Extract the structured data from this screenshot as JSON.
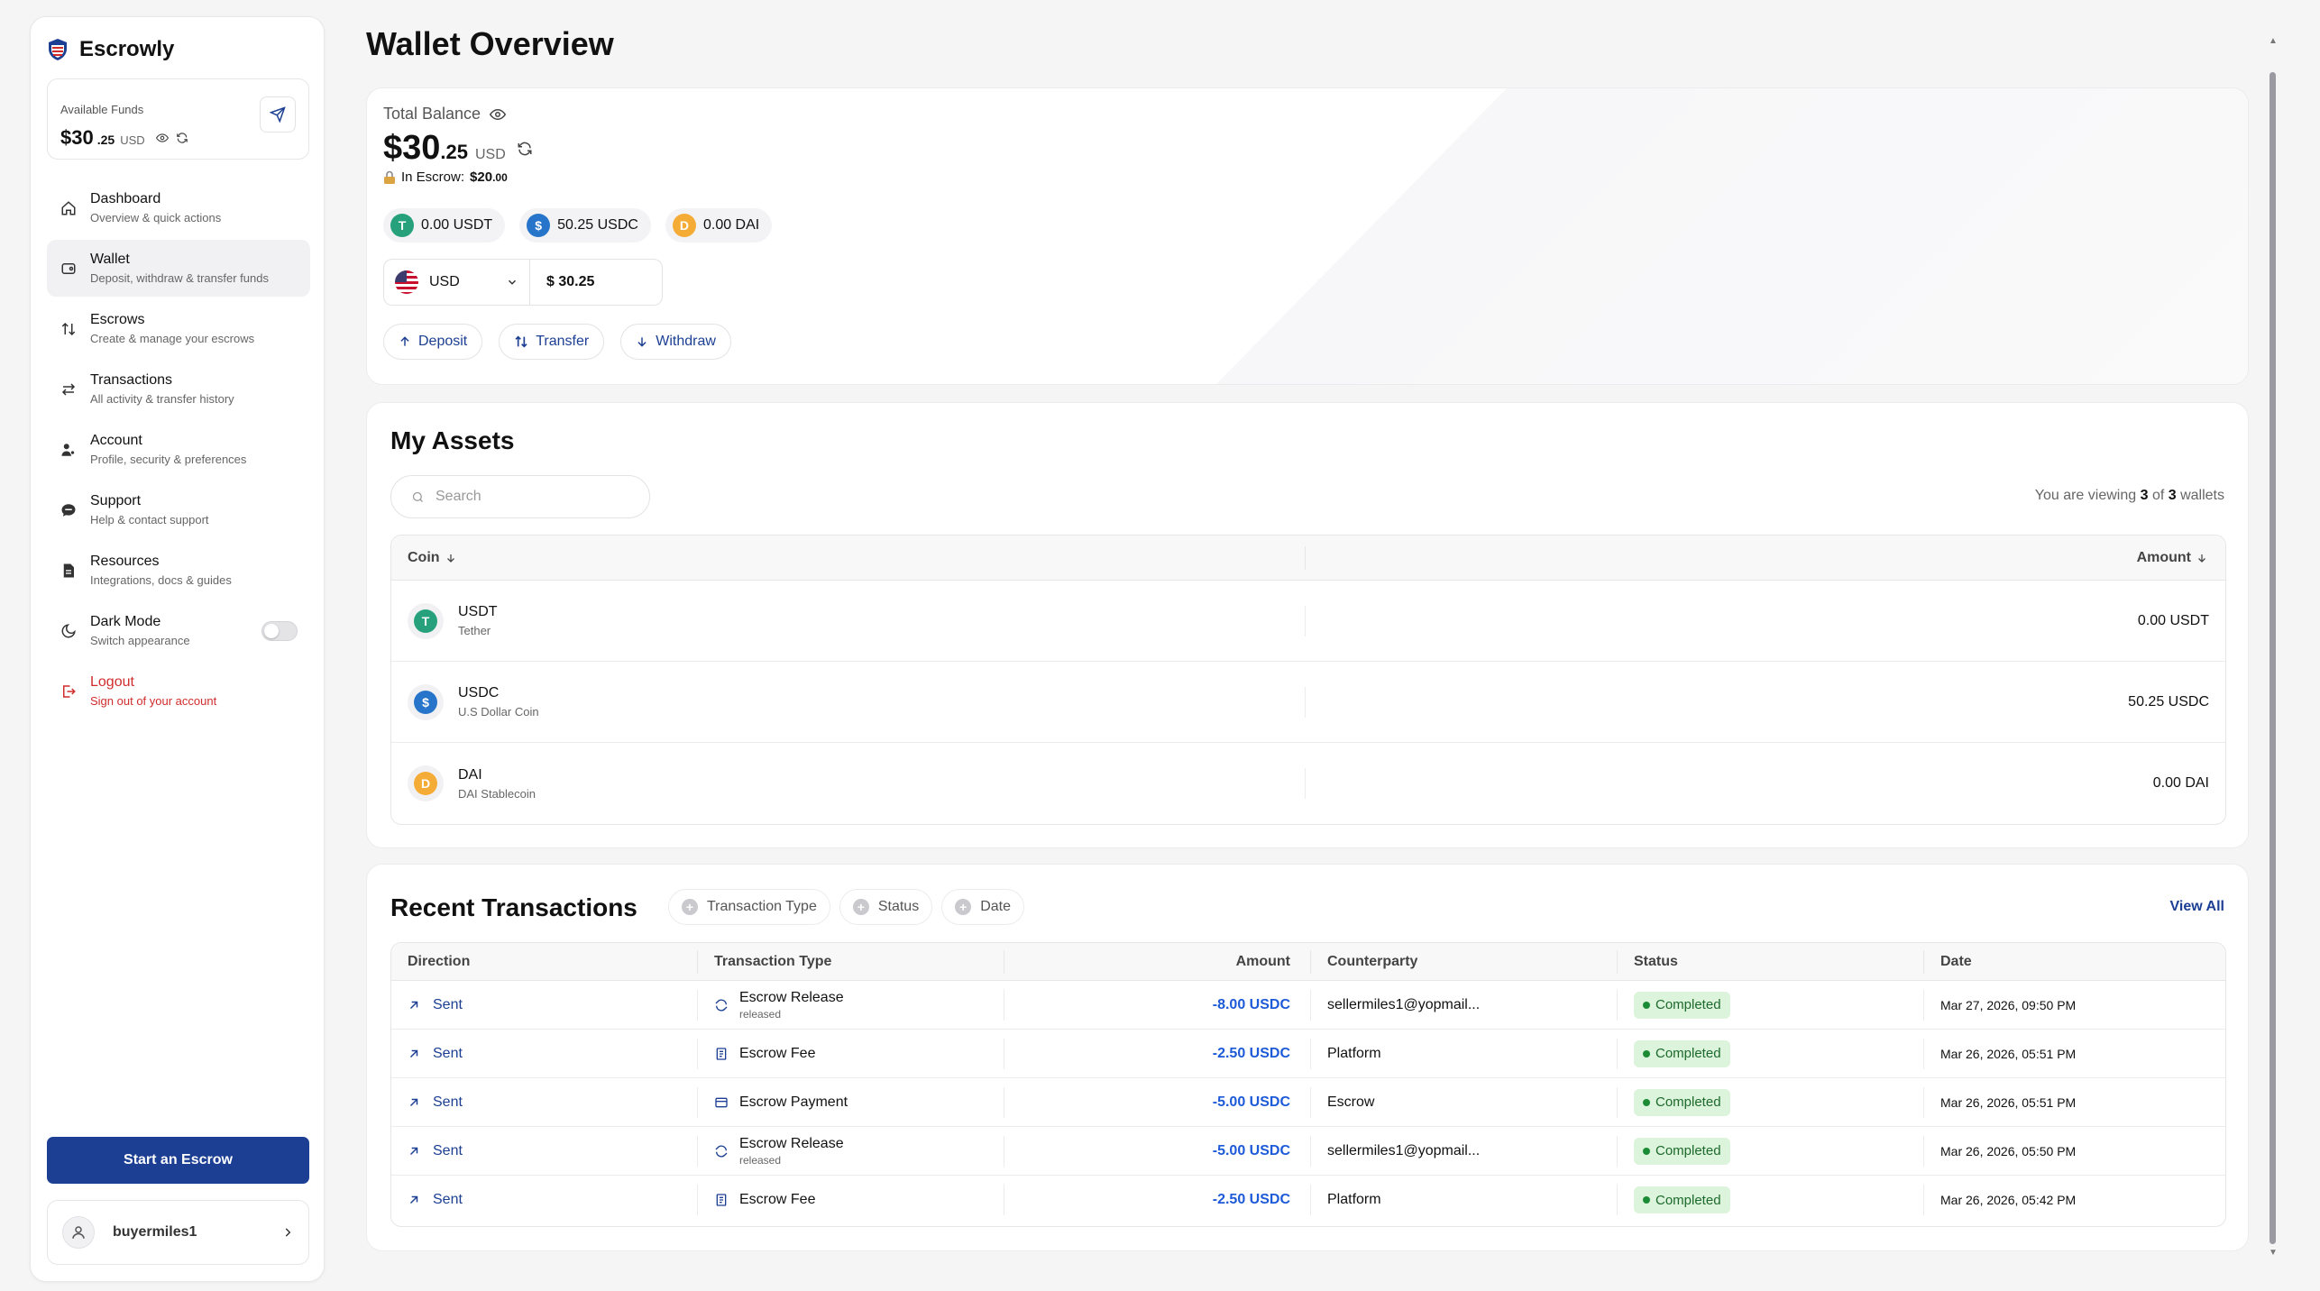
{
  "brand": {
    "name": "Escrowly"
  },
  "funds": {
    "label": "Available Funds",
    "int": "$30",
    "dec": ".25",
    "currency": "USD"
  },
  "nav": [
    {
      "title": "Dashboard",
      "sub": "Overview & quick actions"
    },
    {
      "title": "Wallet",
      "sub": "Deposit, withdraw & transfer funds"
    },
    {
      "title": "Escrows",
      "sub": "Create & manage your escrows"
    },
    {
      "title": "Transactions",
      "sub": "All activity & transfer history"
    },
    {
      "title": "Account",
      "sub": "Profile, security & preferences"
    },
    {
      "title": "Support",
      "sub": "Help & contact support"
    },
    {
      "title": "Resources",
      "sub": "Integrations, docs & guides"
    },
    {
      "title": "Dark Mode",
      "sub": "Switch appearance"
    },
    {
      "title": "Logout",
      "sub": "Sign out of your account"
    }
  ],
  "start_escrow": "Start an Escrow",
  "user": {
    "name": "buyermiles1"
  },
  "page_title": "Wallet Overview",
  "balance": {
    "label": "Total Balance",
    "int": "$30",
    "dec": ".25",
    "currency": "USD",
    "escrow_label": "In Escrow:",
    "escrow_value": "$20",
    "escrow_dec": ".00",
    "chips": [
      "0.00 USDT",
      "50.25 USDC",
      "0.00 DAI"
    ],
    "currency_select": "USD",
    "converted": "$ 30.25",
    "actions": [
      "Deposit",
      "Transfer",
      "Withdraw"
    ]
  },
  "assets": {
    "title": "My Assets",
    "search_placeholder": "Search",
    "viewing_prefix": "You are viewing",
    "viewing_count": "3",
    "viewing_of": "of",
    "viewing_total": "3",
    "viewing_suffix": "wallets",
    "col_coin": "Coin",
    "col_amount": "Amount",
    "rows": [
      {
        "symbol": "USDT",
        "name": "Tether",
        "amount": "0.00 USDT"
      },
      {
        "symbol": "USDC",
        "name": "U.S Dollar Coin",
        "amount": "50.25 USDC"
      },
      {
        "symbol": "DAI",
        "name": "DAI Stablecoin",
        "amount": "0.00 DAI"
      }
    ]
  },
  "transactions": {
    "title": "Recent Transactions",
    "filters": [
      "Transaction Type",
      "Status",
      "Date"
    ],
    "view_all": "View All",
    "headers": [
      "Direction",
      "Transaction Type",
      "Amount",
      "Counterparty",
      "Status",
      "Date"
    ],
    "rows": [
      {
        "direction": "Sent",
        "type": "Escrow Release",
        "sub": "released",
        "amount": "-8.00 USDC",
        "counterparty": "sellermiles1@yopmail...",
        "status": "Completed",
        "date": "Mar 27, 2026, 09:50 PM"
      },
      {
        "direction": "Sent",
        "type": "Escrow Fee",
        "sub": "",
        "amount": "-2.50 USDC",
        "counterparty": "Platform",
        "status": "Completed",
        "date": "Mar 26, 2026, 05:51 PM"
      },
      {
        "direction": "Sent",
        "type": "Escrow Payment",
        "sub": "",
        "amount": "-5.00 USDC",
        "counterparty": "Escrow",
        "status": "Completed",
        "date": "Mar 26, 2026, 05:51 PM"
      },
      {
        "direction": "Sent",
        "type": "Escrow Release",
        "sub": "released",
        "amount": "-5.00 USDC",
        "counterparty": "sellermiles1@yopmail...",
        "status": "Completed",
        "date": "Mar 26, 2026, 05:50 PM"
      },
      {
        "direction": "Sent",
        "type": "Escrow Fee",
        "sub": "",
        "amount": "-2.50 USDC",
        "counterparty": "Platform",
        "status": "Completed",
        "date": "Mar 26, 2026, 05:42 PM"
      }
    ]
  },
  "colors": {
    "accent": "#1c3f93",
    "amount": "#1d5ad8",
    "success_bg": "#dcf3dc",
    "danger": "#d12c2c"
  }
}
